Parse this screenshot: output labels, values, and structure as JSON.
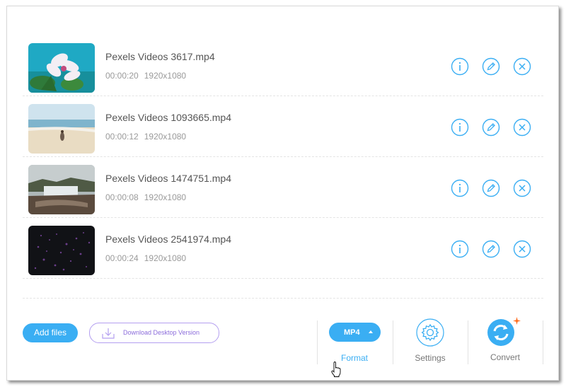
{
  "files": [
    {
      "name": "Pexels Videos 3617.mp4",
      "duration": "00:00:20",
      "resolution": "1920x1080",
      "thumb": "flower"
    },
    {
      "name": "Pexels Videos 1093665.mp4",
      "duration": "00:00:12",
      "resolution": "1920x1080",
      "thumb": "beach"
    },
    {
      "name": "Pexels Videos 1474751.mp4",
      "duration": "00:00:08",
      "resolution": "1920x1080",
      "thumb": "waterfall"
    },
    {
      "name": "Pexels Videos 2541974.mp4",
      "duration": "00:00:24",
      "resolution": "1920x1080",
      "thumb": "particles"
    }
  ],
  "row_actions": {
    "info_icon": "info-icon",
    "edit_icon": "edit-icon",
    "remove_icon": "close-icon"
  },
  "toolbar": {
    "add_files_label": "Add files",
    "download_label": "Download Desktop Version",
    "format_value": "MP4",
    "format_label": "Format",
    "settings_label": "Settings",
    "convert_label": "Convert"
  },
  "colors": {
    "accent": "#3aaef3",
    "download_border": "#b49ff0",
    "download_text": "#8c6ddb",
    "sparkle": "#ff6a1a",
    "text_primary": "#555555",
    "text_muted": "#9a9a9a"
  }
}
